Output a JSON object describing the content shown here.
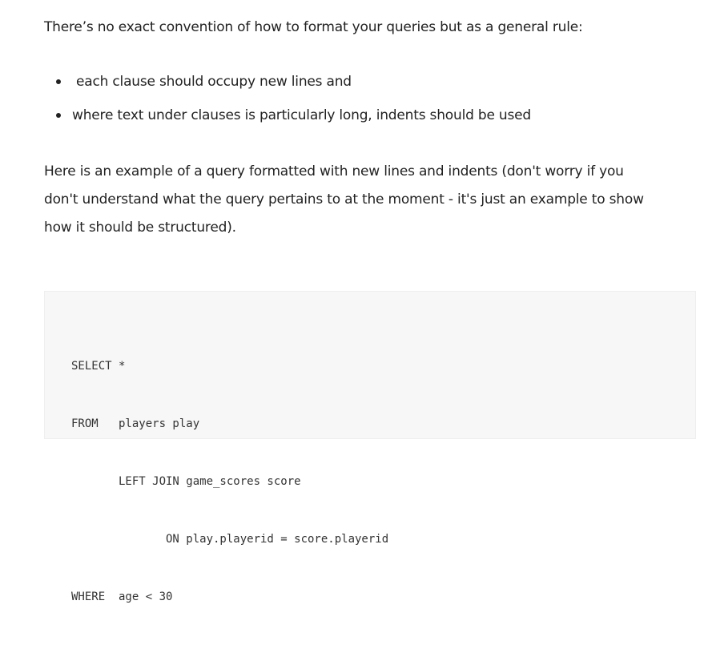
{
  "intro": "There’s no exact convention of how to format your queries but as a general rule:",
  "bullets": [
    "each clause should occupy new lines and",
    "where text under clauses is particularly long, indents should be used"
  ],
  "paragraph_lines": [
    "Here is an example of a query formatted with new lines and indents (don't worry if you",
    "don't understand what the query pertains to at the moment - it's just an example to show",
    "how it should be structured)."
  ],
  "code_lines": [
    "SELECT *",
    "FROM   players play",
    "       LEFT JOIN game_scores score",
    "              ON play.playerid = score.playerid",
    "WHERE  age < 30"
  ]
}
